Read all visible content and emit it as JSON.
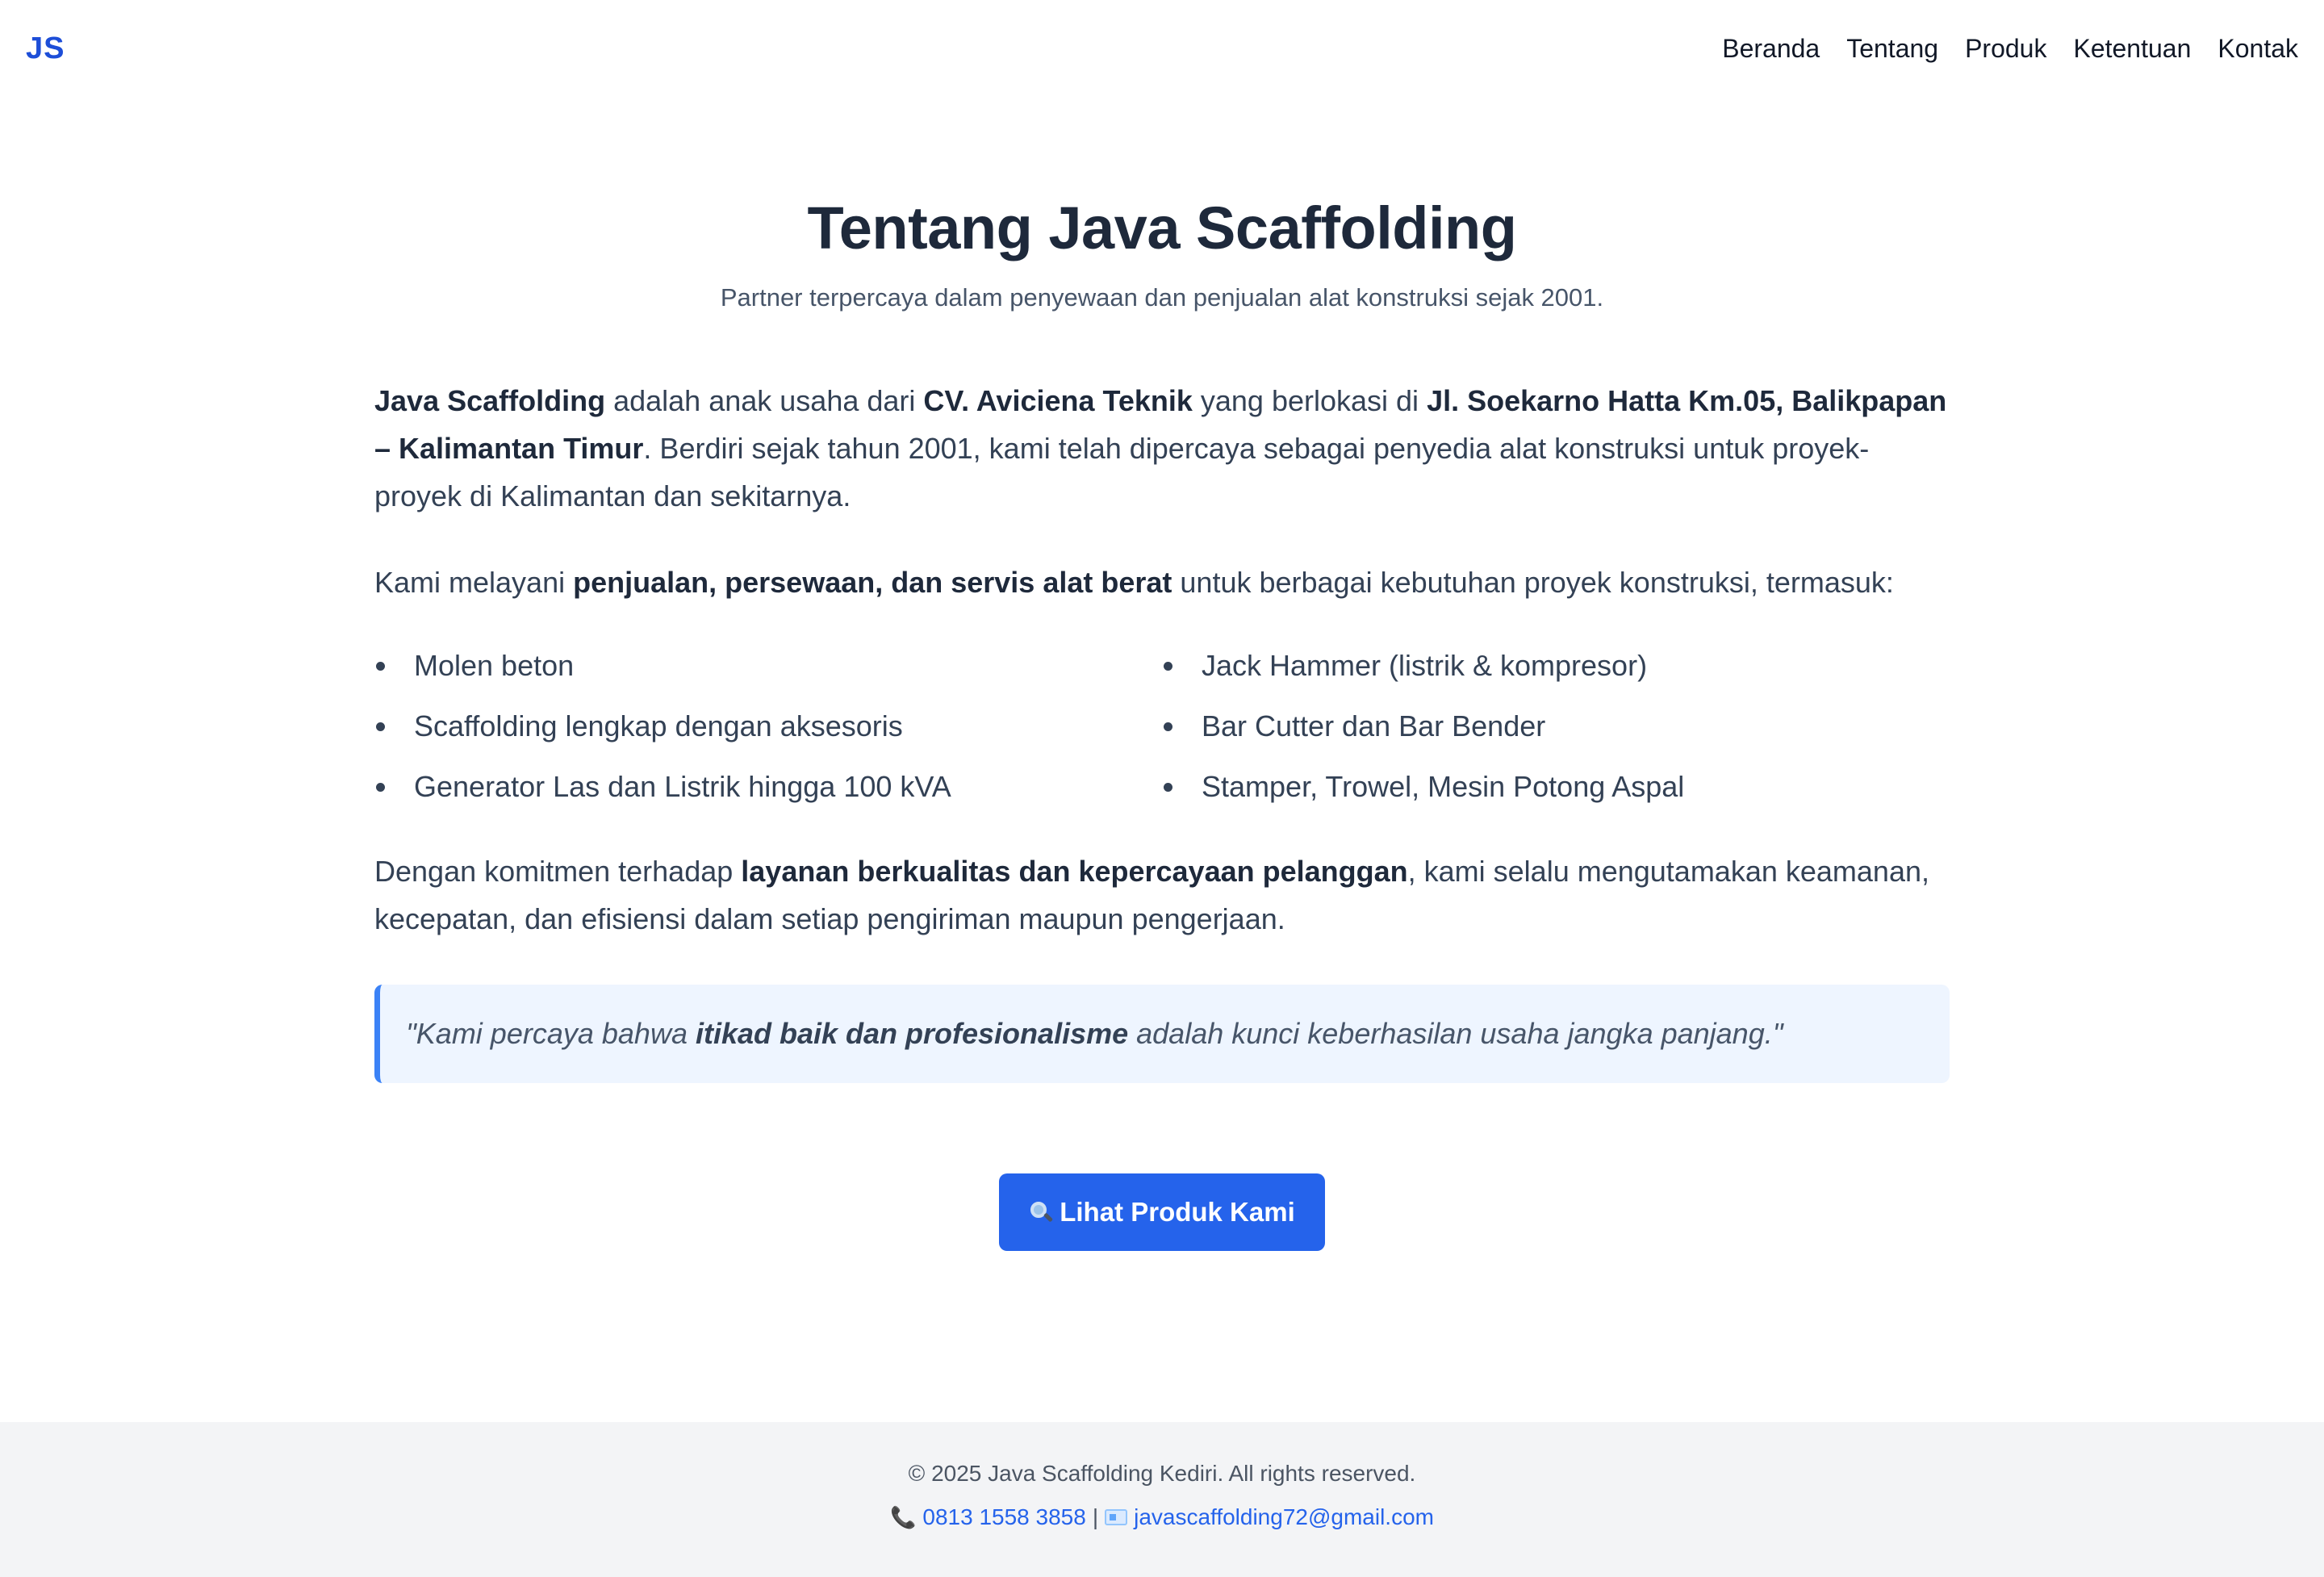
{
  "header": {
    "logo": "JS",
    "nav": [
      "Beranda",
      "Tentang",
      "Produk",
      "Ketentuan",
      "Kontak"
    ]
  },
  "main": {
    "title": "Tentang Java Scaffolding",
    "subtitle": "Partner terpercaya dalam penyewaan dan penjualan alat konstruksi sejak 2001.",
    "p1": {
      "company": "Java Scaffolding",
      "t1": " adalah anak usaha dari ",
      "parent": "CV. Aviciena Teknik",
      "t2": " yang berlokasi di ",
      "location": "Jl. Soekarno Hatta Km.05, Balikpapan – Kalimantan Timur",
      "t3": ". Berdiri sejak tahun 2001, kami telah dipercaya sebagai penyedia alat konstruksi untuk proyek-proyek di Kalimantan dan sekitarnya."
    },
    "p2": {
      "t1": "Kami melayani ",
      "services": "penjualan, persewaan, dan servis alat berat",
      "t2": " untuk berbagai kebutuhan proyek konstruksi, termasuk:"
    },
    "services_list": [
      "Molen beton",
      "Jack Hammer (listrik & kompresor)",
      "Scaffolding lengkap dengan aksesoris",
      "Bar Cutter dan Bar Bender",
      "Generator Las dan Listrik hingga 100 kVA",
      "Stamper, Trowel, Mesin Potong Aspal"
    ],
    "p3": {
      "t1": "Dengan komitmen terhadap ",
      "commitment": "layanan berkualitas dan kepercayaan pelanggan",
      "t2": ", kami selalu mengutamakan keamanan, kecepatan, dan efisiensi dalam setiap pengiriman maupun pengerjaan."
    },
    "quote": {
      "t1": "\"Kami percaya bahwa ",
      "emphasis": "itikad baik dan profesionalisme",
      "t2": " adalah kunci keberhasilan usaha jangka panjang.\""
    },
    "cta_label": "Lihat Produk Kami"
  },
  "footer": {
    "copyright": "© 2025 Java Scaffolding Kediri. All rights reserved.",
    "phone": "0813 1558 3858",
    "separator": "|",
    "email": "javascaffolding72@gmail.com"
  },
  "colors": {
    "accent": "#2563eb",
    "logo": "#1d4ed8",
    "quote_bg": "#eef5ff",
    "quote_border": "#3b82f6",
    "footer_bg": "#f3f4f6"
  },
  "icons": {
    "cta": "search-icon",
    "phone": "phone-icon",
    "email": "email-icon"
  }
}
